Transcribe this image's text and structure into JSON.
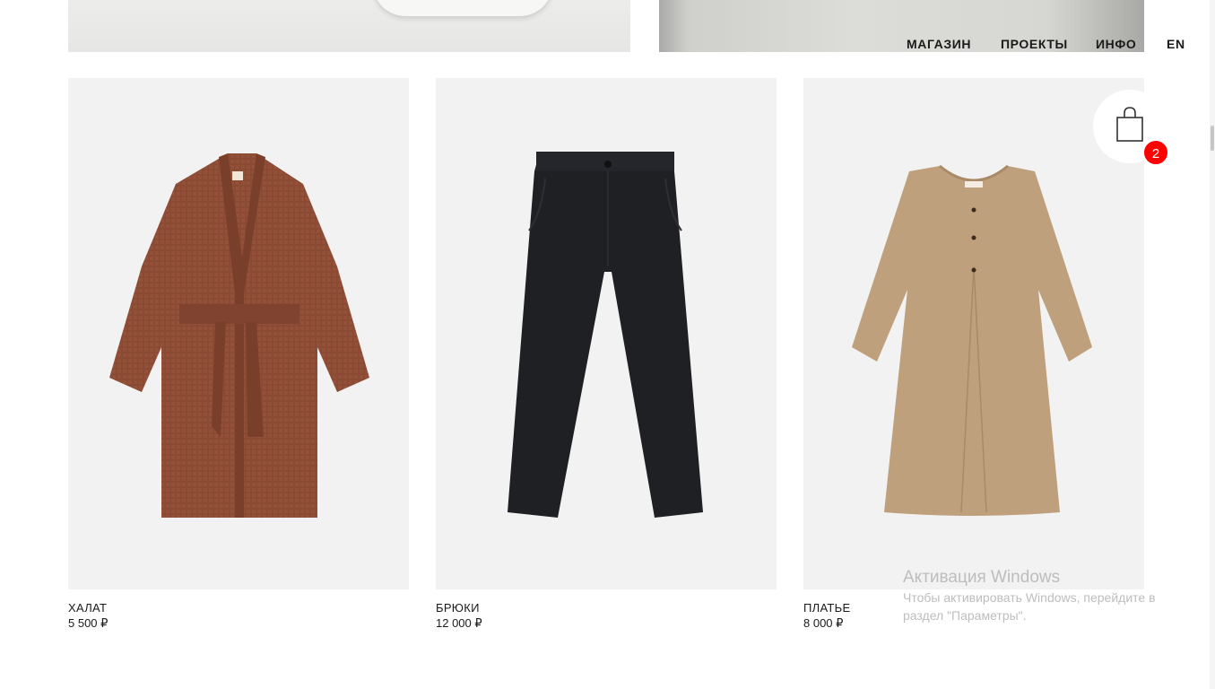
{
  "nav": {
    "shop": "МАГАЗИН",
    "projects": "ПРОЕКТЫ",
    "info": "ИНФО",
    "lang": "EN"
  },
  "products": [
    {
      "name": "ХАЛАТ",
      "price": "5 500 ₽",
      "color": "#8b4a34"
    },
    {
      "name": "БРЮКИ",
      "price": "12 000 ₽",
      "color": "#1f2024"
    },
    {
      "name": "ПЛАТЬЕ",
      "price": "8 000 ₽",
      "color": "#bfa07c"
    }
  ],
  "cart": {
    "count": "2",
    "badge_color": "#ff0000"
  },
  "watermark": {
    "title": "Активация Windows",
    "text": "Чтобы активировать Windows, перейдите в раздел \"Параметры\"."
  }
}
